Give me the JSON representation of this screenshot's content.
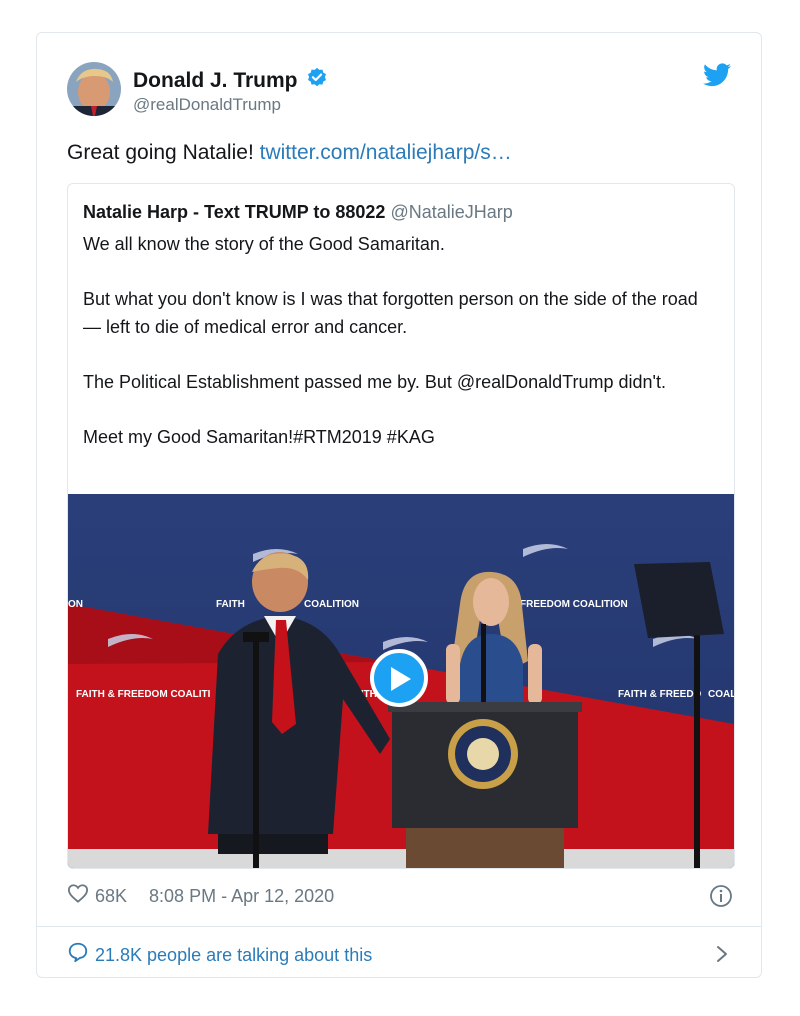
{
  "tweet": {
    "author_name": "Donald J. Trump",
    "author_handle": "@realDonaldTrump",
    "text_prefix": "Great going Natalie! ",
    "link_text": "twitter.com/nataliejharp/s…",
    "likes": "68K",
    "timestamp": "8:08 PM - Apr 12, 2020",
    "talking": "21.8K people are talking about this"
  },
  "quoted": {
    "author_name": "Natalie Harp - Text TRUMP to 88022",
    "author_handle": "@NatalieJHarp",
    "paragraphs": [
      "We all know the story of the Good Samaritan.",
      "But what you don't know is I was that forgotten person on the side of the road — left to die of medical error and cancer.",
      "The Political Establishment passed me by. But @realDonaldTrump didn't.",
      "Meet my Good Samaritan!#RTM2019 #KAG"
    ]
  },
  "video": {
    "backdrop_text_1": "FAITH & FREEDOM COALITION",
    "backdrop_text_2": "FAITH",
    "backdrop_text_3": "COALITION",
    "backdrop_text_4": "FREEDOM COALITION",
    "backdrop_text_5": "FAITH & FREEDOM COALITI",
    "backdrop_text_6": "FAITH & FREEDO",
    "backdrop_text_7": "COALI",
    "backdrop_text_8": "ON",
    "backdrop_text_9": "FAITH"
  },
  "icons": {
    "verified": "verified-badge-icon",
    "twitter": "twitter-bird-icon",
    "like": "heart-icon",
    "info": "info-icon",
    "reply": "speech-bubble-icon",
    "chevron": "chevron-right-icon",
    "play": "play-icon"
  },
  "colors": {
    "brand_blue": "#1da1f2",
    "link_blue": "#2b7bb9",
    "muted": "#697882",
    "border": "#e1e8ed"
  }
}
